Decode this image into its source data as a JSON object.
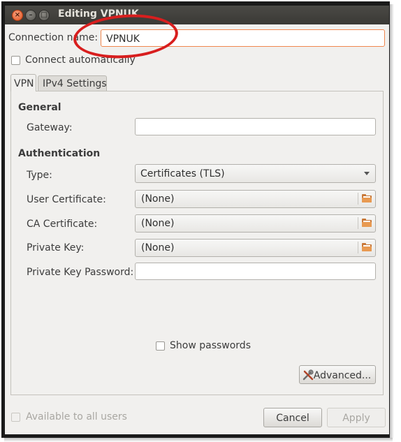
{
  "window": {
    "title": "Editing VPNUK",
    "close_glyph": "×",
    "minimize_glyph": "–",
    "maximize_glyph": "□"
  },
  "connection": {
    "name_label": "Connection name:",
    "name_value": "VPNUK",
    "connect_auto_label": "Connect automatically",
    "connect_auto_checked": false
  },
  "tabs": [
    {
      "label": "VPN",
      "active": true
    },
    {
      "label": "IPv4 Settings",
      "active": false
    }
  ],
  "vpn": {
    "general_heading": "General",
    "gateway_label": "Gateway:",
    "gateway_value": "",
    "auth_heading": "Authentication",
    "type_label": "Type:",
    "type_value": "Certificates (TLS)",
    "user_cert_label": "User Certificate:",
    "user_cert_value": "(None)",
    "ca_cert_label": "CA Certificate:",
    "ca_cert_value": "(None)",
    "private_key_label": "Private Key:",
    "private_key_value": "(None)",
    "private_key_password_label": "Private Key Password:",
    "private_key_password_value": "",
    "show_passwords_label": "Show passwords",
    "show_passwords_checked": false,
    "advanced_label": "Advanced..."
  },
  "footer": {
    "available_all_users_label": "Available to all users",
    "available_all_users_checked": false,
    "cancel_label": "Cancel",
    "apply_label": "Apply"
  },
  "annotation": {
    "color": "#d81e1e"
  },
  "colors": {
    "focus_border": "#f0864e",
    "titlebar": "#3c3b37",
    "close_button": "#e0521f"
  }
}
